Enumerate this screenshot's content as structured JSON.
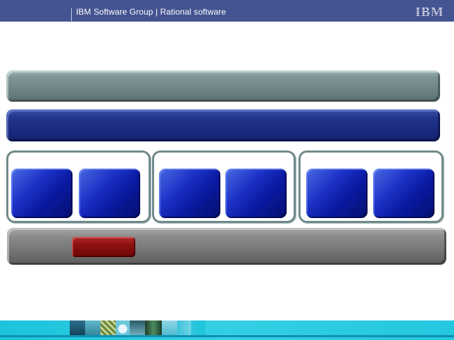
{
  "header": {
    "title": "IBM Software Group  |  Rational software",
    "logo_text": "IBM"
  },
  "colors": {
    "header_bg": "#3f4f8e",
    "bar_top": "#7f9696",
    "bar_mid": "#1a2a7e",
    "bar_bottom": "#767676",
    "tile_blue": "#1d33c8",
    "red_block": "#8e1010",
    "group_border": "#708989",
    "footer_bg": "#1cc4dc"
  },
  "diagram": {
    "groups": [
      {
        "tiles": 2
      },
      {
        "tiles": 2
      },
      {
        "tiles": 2
      }
    ]
  },
  "footer": {
    "collage_icon": "image-collage-strip"
  }
}
